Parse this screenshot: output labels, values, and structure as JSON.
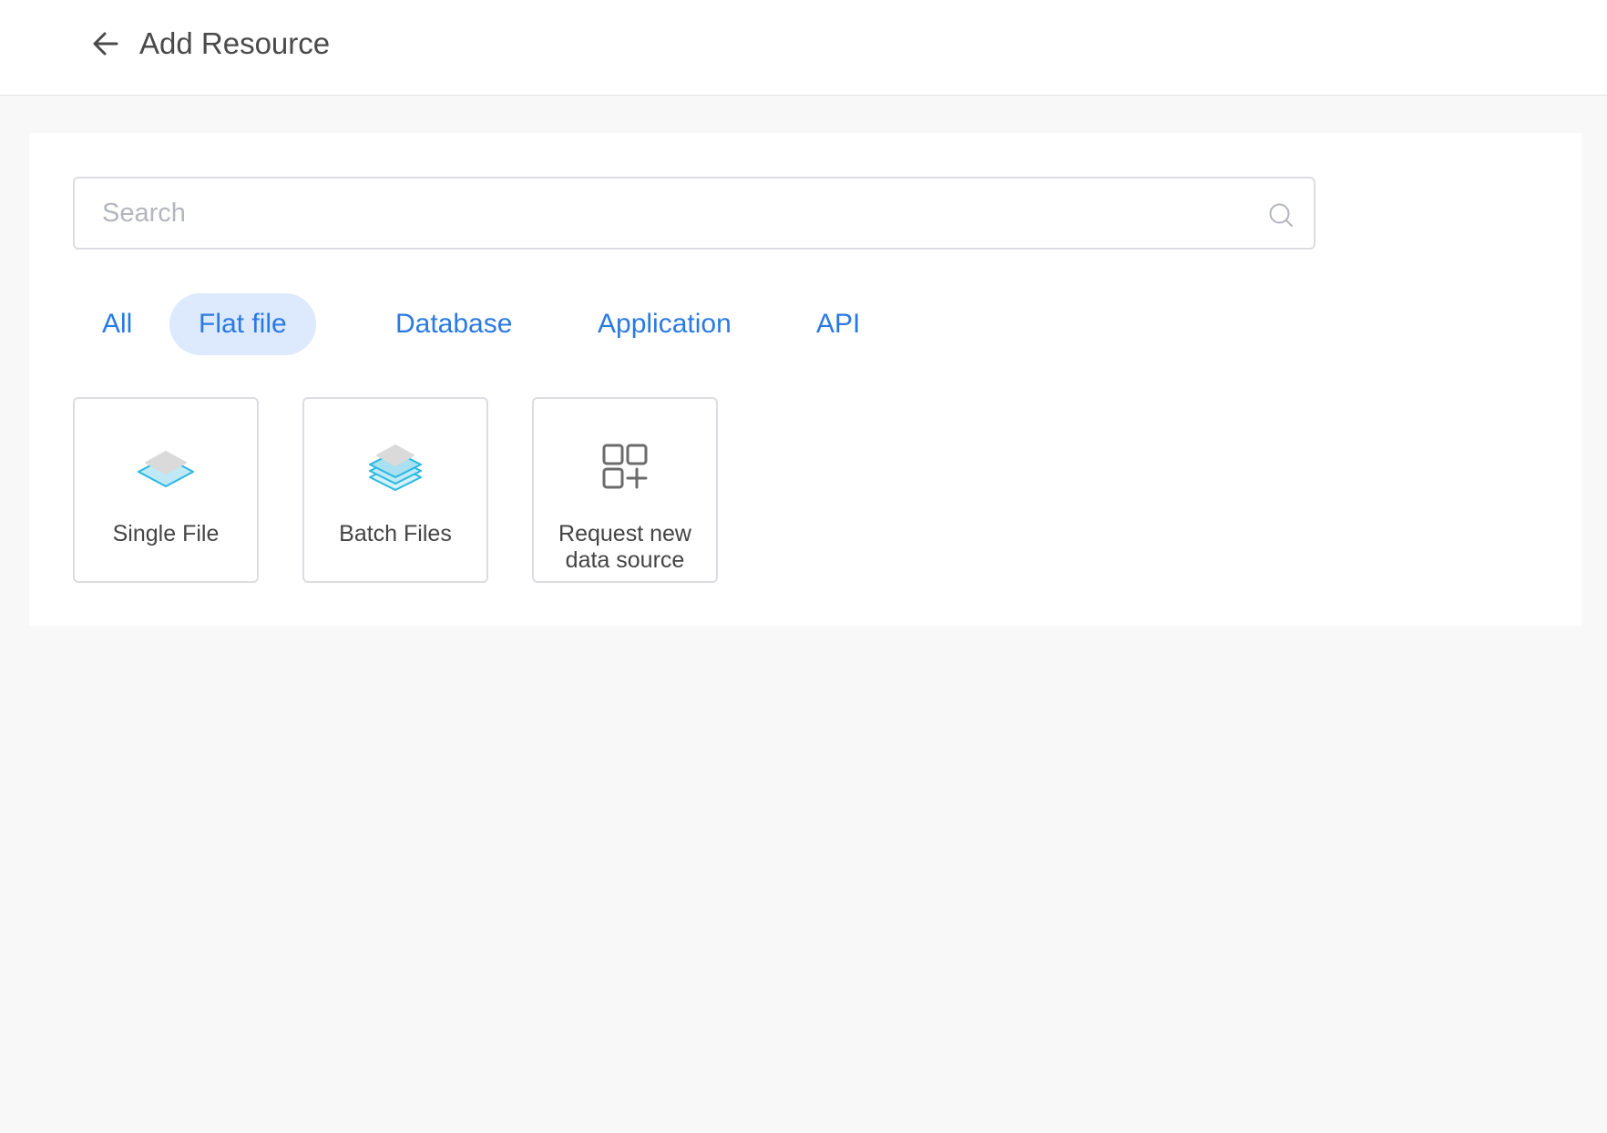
{
  "header": {
    "back_icon": "arrow-left-icon",
    "title": "Add Resource"
  },
  "search": {
    "placeholder": "Search",
    "value": "",
    "icon": "search-icon"
  },
  "tabs": [
    {
      "label": "All",
      "active": false
    },
    {
      "label": "Flat file",
      "active": true
    },
    {
      "label": "Database",
      "active": false
    },
    {
      "label": "Application",
      "active": false
    },
    {
      "label": "API",
      "active": false
    }
  ],
  "cards": [
    {
      "label": "Single File",
      "icon": "single-file-icon"
    },
    {
      "label": "Batch Files",
      "icon": "batch-files-icon"
    },
    {
      "label_line1": "Request new",
      "label_line2": "data source",
      "icon": "add-grid-icon"
    }
  ],
  "colors": {
    "accent": "#2a7ae2",
    "tab_active_bg": "#dde9fd",
    "layer_blue": "#28b8e0",
    "layer_fill": "#bfe9f7",
    "layer_gray": "#d9d9d9"
  }
}
